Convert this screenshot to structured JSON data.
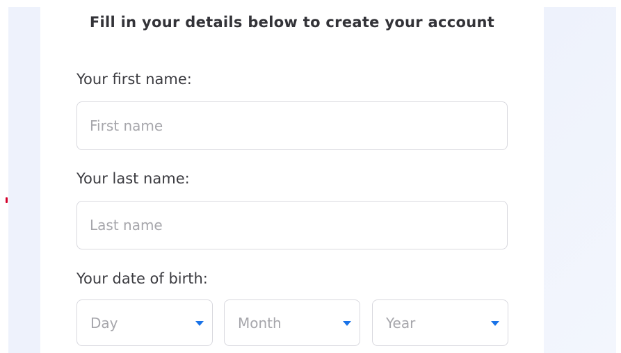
{
  "heading": "Fill in your details below to create your account",
  "first_name": {
    "label": "Your first name:",
    "placeholder": "First name"
  },
  "last_name": {
    "label": "Your last name:",
    "placeholder": "Last name"
  },
  "date_of_birth": {
    "label": "Your date of birth:",
    "day": "Day",
    "month": "Month",
    "year": "Year",
    "caret_icon": "caret-down-icon",
    "caret_color": "#1a73e8"
  }
}
